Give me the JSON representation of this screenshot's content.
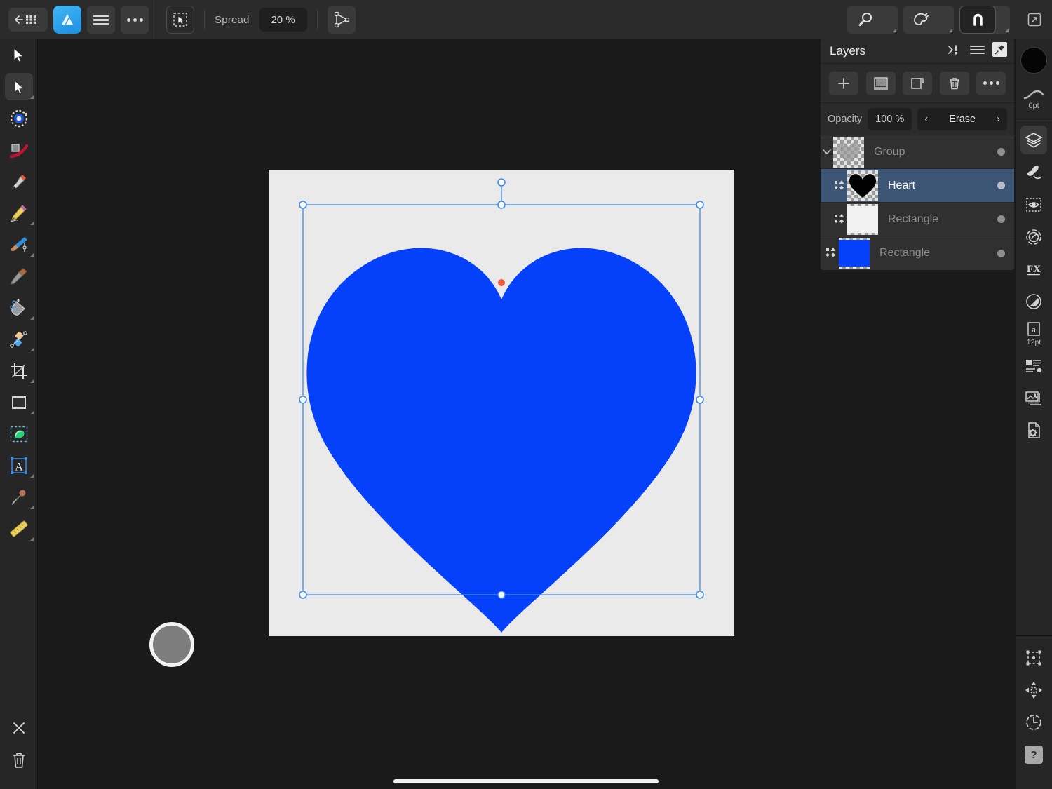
{
  "app": {
    "name": "Affinity Designer",
    "platform_bar": "home-indicator"
  },
  "toolbar": {
    "back_label": "back-to-documents",
    "logo_label": "affinity-designer",
    "menu_label": "menu",
    "more_label": "more",
    "tool_mode_label": "node-select",
    "spread_label": "Spread",
    "spread_value": "20 %",
    "mesh_label": "mesh-gradient",
    "zoom_label": "zoom-tool",
    "color_label": "color-picker",
    "snap_label": "snapping",
    "expand_label": "expand-panel"
  },
  "left_tools": [
    {
      "name": "move-tool",
      "label": "Move"
    },
    {
      "name": "node-tool",
      "label": "Node",
      "selected": true,
      "flyout": true
    },
    {
      "name": "corner-tool",
      "label": "Corner"
    },
    {
      "name": "shape-builder",
      "label": "Shape Builder"
    },
    {
      "name": "pen-tool",
      "label": "Pen",
      "flyout": true
    },
    {
      "name": "pencil-tool",
      "label": "Pencil",
      "flyout": true
    },
    {
      "name": "paint-brush-tool",
      "label": "Paint Brush",
      "flyout": true
    },
    {
      "name": "fill-brush-tool",
      "label": "Fill Brush"
    },
    {
      "name": "flood-fill-tool",
      "label": "Flood Fill",
      "flyout": true
    },
    {
      "name": "gradient-tool",
      "label": "Gradient",
      "flyout": true
    },
    {
      "name": "crop-tool",
      "label": "Crop",
      "flyout": true
    },
    {
      "name": "rectangle-tool",
      "label": "Rectangle",
      "flyout": true
    },
    {
      "name": "selection-brush",
      "label": "Selection Brush"
    },
    {
      "name": "text-tool",
      "label": "Text",
      "flyout": true
    },
    {
      "name": "color-picker-tool",
      "label": "Color Picker",
      "flyout": true
    },
    {
      "name": "measure-tool",
      "label": "Measure",
      "flyout": true
    }
  ],
  "left_bottom": [
    {
      "name": "close-button",
      "label": "Close"
    },
    {
      "name": "delete-button",
      "label": "Delete"
    }
  ],
  "float_slider": {
    "value_label": "0.0pt",
    "eye_label": "visibility-toggle"
  },
  "canvas": {
    "artboard_color": "#eaeaea",
    "shape_name": "Heart",
    "shape_fill": "#0540fb",
    "selection_color": "#3d8ce8",
    "node_color": "#f05a3c",
    "puck_label": "color-puck"
  },
  "layers_panel": {
    "title": "Layers",
    "header_icons": [
      {
        "name": "collapse-all-icon"
      },
      {
        "name": "list-options-icon"
      },
      {
        "name": "pin-icon"
      }
    ],
    "tool_buttons": [
      {
        "name": "add-layer-button",
        "label": "Add"
      },
      {
        "name": "mask-layer-button",
        "label": "Mask"
      },
      {
        "name": "duplicate-layer-button",
        "label": "Duplicate"
      },
      {
        "name": "delete-layer-button",
        "label": "Delete"
      },
      {
        "name": "layer-more-button",
        "label": "More"
      }
    ],
    "opacity_label": "Opacity",
    "opacity_value": "100 %",
    "blend_mode": "Erase",
    "blend_prev": "‹",
    "blend_next": "›",
    "layers": [
      {
        "name": "Group",
        "type": "group",
        "selected": false,
        "indent": 0,
        "expanded": true,
        "thumb": "heart-checker",
        "visible": true
      },
      {
        "name": "Heart",
        "type": "curve",
        "selected": true,
        "indent": 1,
        "expanded": false,
        "thumb": "heart-black",
        "visible": true
      },
      {
        "name": "Rectangle",
        "type": "rectangle",
        "selected": false,
        "indent": 1,
        "expanded": false,
        "thumb": "rect-white",
        "visible": true
      },
      {
        "name": "Rectangle",
        "type": "rectangle",
        "selected": false,
        "indent": 0,
        "expanded": false,
        "thumb": "rect-blue",
        "visible": true
      }
    ]
  },
  "studio": {
    "color_swatch": "#050505",
    "stroke_width": "0pt",
    "font_size": "12pt",
    "items": [
      {
        "name": "layers-studio-icon",
        "label": "Layers",
        "active": true
      },
      {
        "name": "brushes-studio-icon",
        "label": "Brushes"
      },
      {
        "name": "stock-studio-icon",
        "label": "Stock"
      },
      {
        "name": "adjustment-studio-icon",
        "label": "Adjustment"
      },
      {
        "name": "effects-studio-icon",
        "label": "Effects"
      },
      {
        "name": "opacity-studio-icon",
        "label": "Opacity"
      },
      {
        "name": "character-studio-icon",
        "label": "Character"
      },
      {
        "name": "paragraph-studio-icon",
        "label": "Paragraph"
      },
      {
        "name": "assets-studio-icon",
        "label": "Assets"
      },
      {
        "name": "document-setup-icon",
        "label": "Document Setup"
      }
    ],
    "bottom_items": [
      {
        "name": "transform-studio-icon",
        "label": "Transform"
      },
      {
        "name": "navigator-studio-icon",
        "label": "Navigator"
      },
      {
        "name": "history-studio-icon",
        "label": "History"
      },
      {
        "name": "help-studio-icon",
        "label": "?"
      }
    ]
  }
}
